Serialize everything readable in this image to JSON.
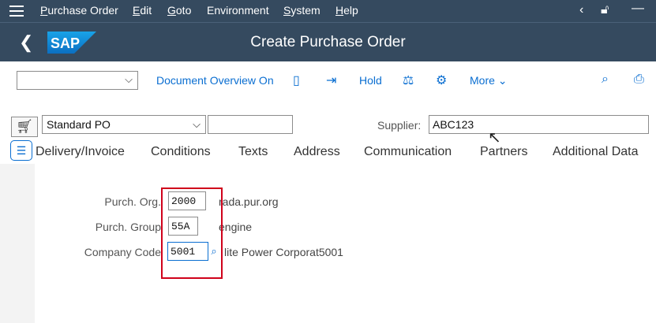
{
  "menu": {
    "items": [
      {
        "label": "Purchase Order",
        "mnemonic": "P",
        "rest": "urchase Order"
      },
      {
        "label": "Edit",
        "mnemonic": "E",
        "rest": "dit"
      },
      {
        "label": "Goto",
        "mnemonic": "G",
        "rest": "oto"
      },
      {
        "label": "Environment",
        "mnemonic": "",
        "rest": "Environment"
      },
      {
        "label": "System",
        "mnemonic": "S",
        "rest": "ystem"
      },
      {
        "label": "Help",
        "mnemonic": "H",
        "rest": "elp"
      }
    ]
  },
  "title": {
    "text": "Create Purchase Order",
    "logo": "SAP"
  },
  "toolbar": {
    "document_overview": "Document Overview On",
    "hold": "Hold",
    "more": "More"
  },
  "header": {
    "po_type": "Standard PO",
    "supplier_label": "Supplier:",
    "supplier_value": "ABC123"
  },
  "tabs": [
    "Delivery/Invoice",
    "Conditions",
    "Texts",
    "Address",
    "Communication",
    "Partners",
    "Additional Data"
  ],
  "org": {
    "purch_org_label": "Purch. Org.",
    "purch_org_value": "2000",
    "purch_org_desc": "rada.pur.org",
    "purch_group_label": "Purch. Group",
    "purch_group_value": "55A",
    "purch_group_desc": "engine",
    "company_code_label": "Company Code",
    "company_code_value": "5001",
    "company_code_desc": "lite Power Corporat5001"
  },
  "colors": {
    "shell": "#354a5f",
    "accent": "#0a6ed1",
    "highlight": "#d0021b"
  }
}
